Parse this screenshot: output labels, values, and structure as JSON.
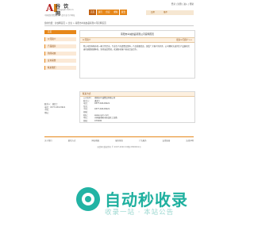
{
  "header": {
    "logo_glyph": "A",
    "site_name": "谷 饮 网",
    "site_url": "www.guyin.com.cn",
    "slogan": "中国优质食饮原料产品行业门户网站",
    "top_links": "登录 | 注册 | 进入 | 帮助",
    "nav": [
      "首页",
      "资讯",
      "供应",
      "求购",
      "展会"
    ],
    "subnav": [
      "品牌",
      "推荐"
    ]
  },
  "breadcrumb": "您的位置：谷饮网首页 > 企业 > 南阳市众诚食品有限公司官网首页",
  "sidebar": {
    "items": [
      "首页",
      "公司简介",
      "产品展示",
      "新闻动态",
      "证书荣誉",
      "联系我们"
    ],
    "extra": [
      "联系人：潘女士",
      "电话：0377-63123621",
      "手机：",
      "地址："
    ]
  },
  "main": {
    "company_title": "南阳市众诚食品有限公司官网首页",
    "intro_heading": "公司简介",
    "more_label": "更多公司简介>>",
    "intro_text": "我公司是南阳市的一家大型企业，专业生产各类食品饮料，产品质量优良，深受广大客户的好评。公司拥有先进的生产设备和完善的质量管理体系，坚持诚信经营，欢迎新老客户前来洽谈合作。"
  },
  "contact": {
    "heading": "联系方式",
    "rows": [
      {
        "k": "公司名称：",
        "v": "南阳市众诚食品有限公司"
      },
      {
        "k": "联系人：",
        "v": "潘女士"
      },
      {
        "k": "电话：",
        "v": "0377-63123621"
      },
      {
        "k": "传真：",
        "v": ""
      },
      {
        "k": "手机：",
        "v": "0377-63123621"
      },
      {
        "k": "邮箱：",
        "v": ""
      },
      {
        "k": "网址：",
        "v": "www.nyzc.com"
      },
      {
        "k": "地址：",
        "v": "河南省南阳市卧龙区工业路"
      },
      {
        "k": "邮编：",
        "v": "473000"
      }
    ]
  },
  "footer": {
    "nav": [
      "关于我们",
      "联系方式",
      "网站地图",
      "服务条款",
      "广告服务",
      "友情链接",
      "法律声明"
    ],
    "copyright": "谷饮网 版权所有 © 2007-2020 ICP备 0800001号"
  },
  "watermark": {
    "title": "自动秒收录",
    "subtitle": "收录一站 · 本站公告"
  },
  "colors": {
    "accent": "#e6871a",
    "brand": "#b31b1b",
    "watermark": "#22b3a4"
  }
}
